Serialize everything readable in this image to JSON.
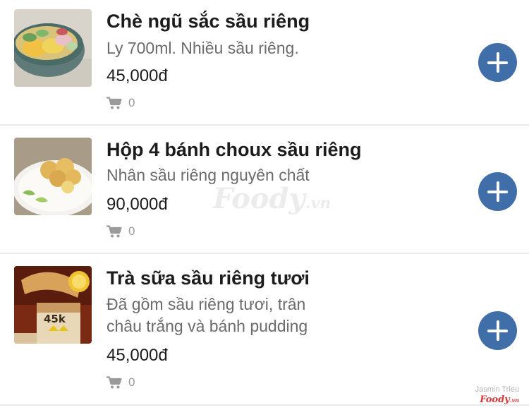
{
  "items": [
    {
      "title": "Chè ngũ sắc sầu riêng",
      "desc_lines": [
        "Ly 700ml. Nhiều sầu riêng."
      ],
      "price": "45,000đ",
      "cart_count": "0",
      "cart_icon": "cart-icon",
      "add_icon": "plus-icon"
    },
    {
      "title": "Hộp 4 bánh choux sầu riêng",
      "desc_lines": [
        "Nhân sầu riêng nguyên chất"
      ],
      "price": "90,000đ",
      "cart_count": "0",
      "cart_icon": "cart-icon",
      "add_icon": "plus-icon"
    },
    {
      "title": "Trà sữa sầu riêng tươi",
      "desc_lines": [
        "Đã gồm sầu riêng tươi, trân",
        "châu trắng và bánh pudding"
      ],
      "price": "45,000đ",
      "cart_count": "0",
      "cart_icon": "cart-icon",
      "add_icon": "plus-icon"
    }
  ],
  "watermark": {
    "brand": "Foody",
    "suffix": ".vn"
  },
  "credit": {
    "name": "Jasmin Trieu",
    "logo": "Foody",
    "logo_suffix": ".vn"
  },
  "colors": {
    "accent": "#3f6ea8",
    "title": "#1c1c1c",
    "desc": "#6b6b6b",
    "muted": "#9a9a9a",
    "divider": "#e9eaec"
  }
}
